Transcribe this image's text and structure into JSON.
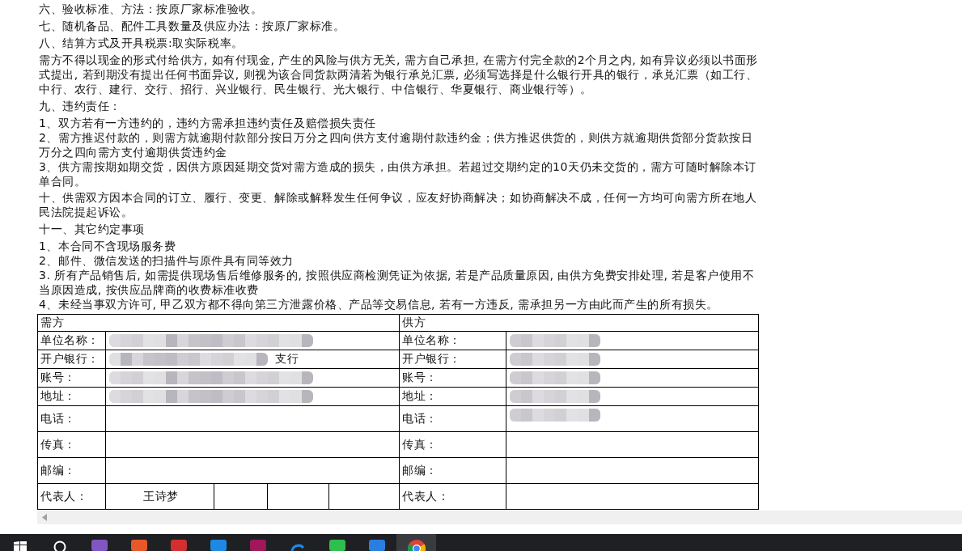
{
  "document": {
    "blocks": [
      {
        "kind": "clause",
        "text": "六、验收标准、方法：按原厂家标准验收。"
      },
      {
        "kind": "clause",
        "text": "七、随机备品、配件工具数量及供应办法：按原厂家标准。"
      },
      {
        "kind": "clause",
        "text": "八、结算方式及开具税票:取实际税率。"
      },
      {
        "kind": "clause",
        "text": "需方不得以现金的形式付给供方, 如有付现金, 产生的风险与供方无关, 需方自己承担, 在需方付完全款的2个月之内, 如有异议必须以书面形式提出, 若到期没有提出任何书面异议, 则视为该合同货款两清若为银行承兑汇票, 必须写选择是什么银行开具的银行，承兑汇票（如工行、中行、农行、建行、交行、招行、兴业银行、民生银行、光大银行、中信银行、华夏银行、商业银行等）。"
      },
      {
        "kind": "clause",
        "text": "九、违约责任："
      },
      {
        "kind": "item",
        "text": "1、双方若有一方违约的，违约方需承担违约责任及赔偿损失责任"
      },
      {
        "kind": "item",
        "text": "2、需方推迟付款的，则需方就逾期付款部分按日万分之四向供方支付逾期付款违约金；供方推迟供货的，则供方就逾期供货部分货款按日万分之四向需方支付逾期供货违约金"
      },
      {
        "kind": "item",
        "text": "3、供方需按期如期交货，因供方原因延期交货对需方造成的损失，由供方承担。若超过交期约定的10天仍未交货的，需方可随时解除本订单合同。"
      },
      {
        "kind": "clause",
        "text": "十、供需双方因本合同的订立、履行、变更、解除或解释发生任何争议，应友好协商解决；如协商解决不成，任何一方均可向需方所在地人民法院提起诉讼。"
      },
      {
        "kind": "clause",
        "text": "十一、其它约定事项"
      },
      {
        "kind": "item",
        "text": "1、本合同不含现场服务费"
      },
      {
        "kind": "item",
        "text": "2、邮件、微信发送的扫描件与原件具有同等效力"
      },
      {
        "kind": "item",
        "text": "3. 所有产品销售后, 如需提供现场售后维修服务的, 按照供应商检测凭证为依据, 若是产品质量原因, 由供方免费安排处理, 若是客户使用不当原因造成, 按供应品牌商的收费标准收费"
      },
      {
        "kind": "item",
        "text": "4、未经当事双方许可, 甲乙双方都不得向第三方泄露价格、产品等交易信息, 若有一方违反, 需承担另一方由此而产生的所有损失。"
      }
    ]
  },
  "table": {
    "header": [
      "需方",
      "供方"
    ],
    "rows": [
      {
        "left": {
          "label": "单位名称：",
          "redacted": true
        },
        "right": {
          "label": "单位名称：",
          "redacted": true
        }
      },
      {
        "left": {
          "label": "开户银行：",
          "value": "支行",
          "redacted": true
        },
        "right": {
          "label": "开户银行：",
          "redacted": true
        }
      },
      {
        "left": {
          "label": "账号：",
          "redacted": true
        },
        "right": {
          "label": "账号：",
          "redacted": true
        }
      },
      {
        "left": {
          "label": "地址：",
          "redacted": true
        },
        "right": {
          "label": "地址：",
          "redacted": true
        }
      },
      {
        "left": {
          "label": "电话：",
          "redacted": false
        },
        "right": {
          "label": "电话：",
          "redacted": true
        }
      },
      {
        "left": {
          "label": "传真：",
          "redacted": false
        },
        "right": {
          "label": "传真：",
          "redacted": false
        }
      },
      {
        "left": {
          "label": "邮编：",
          "redacted": false
        },
        "right": {
          "label": "邮编：",
          "redacted": false
        }
      },
      {
        "kind": "split",
        "left": {
          "label": "代表人：",
          "value": "王诗梦",
          "redacted": false
        },
        "right": {
          "label": "代表人：",
          "redacted": false
        }
      }
    ]
  },
  "taskbar": {
    "apps": [
      {
        "kind": "start"
      },
      {
        "kind": "search"
      },
      {
        "kind": "app",
        "color": "#7e57c2"
      },
      {
        "kind": "app",
        "color": "#e8572a"
      },
      {
        "kind": "app",
        "color": "#d32f2f"
      },
      {
        "kind": "app",
        "color": "#1e88e5"
      },
      {
        "kind": "app",
        "color": "#a0175a"
      },
      {
        "kind": "ring",
        "color": "#1e88e5"
      },
      {
        "kind": "app",
        "color": "#2ebf4f"
      },
      {
        "kind": "app",
        "color": "#2a7de1"
      },
      {
        "kind": "chrome",
        "selected": true
      }
    ]
  }
}
